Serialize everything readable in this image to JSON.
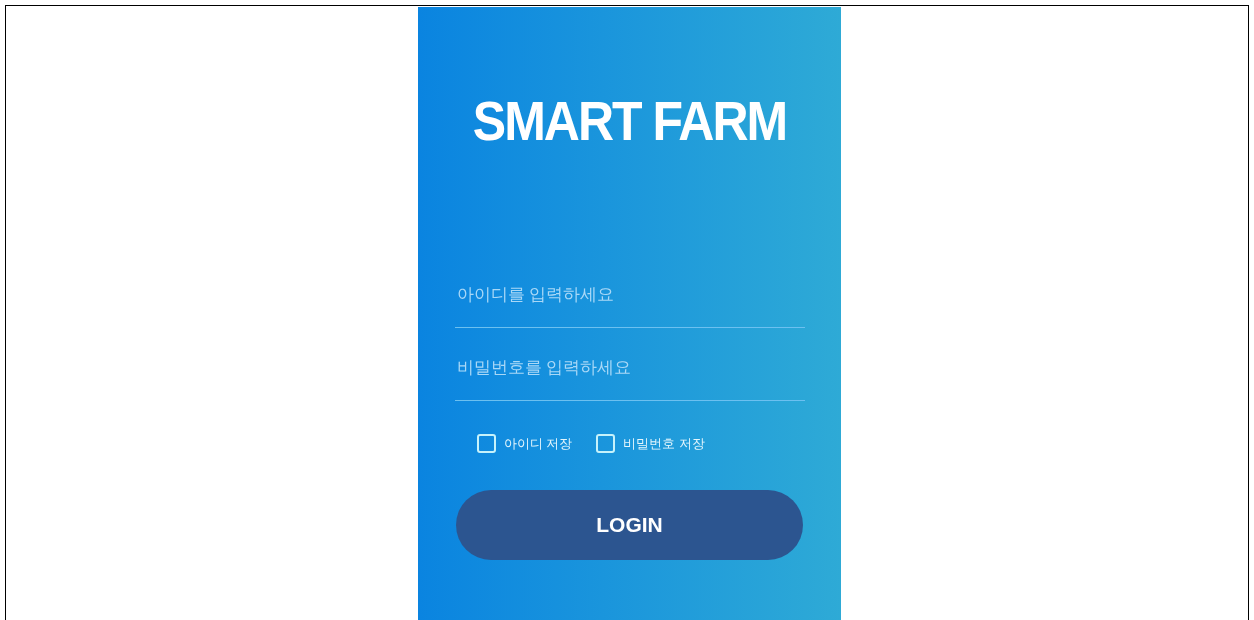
{
  "title": "SMART FARM",
  "fields": [
    {
      "placeholder": "아이디를 입력하세요"
    },
    {
      "placeholder": "비밀번호를 입력하세요"
    }
  ],
  "options": [
    {
      "label": "아이디 저장",
      "checked": false
    },
    {
      "label": "비밀번호 저장",
      "checked": false
    }
  ],
  "login_button": "LOGIN"
}
